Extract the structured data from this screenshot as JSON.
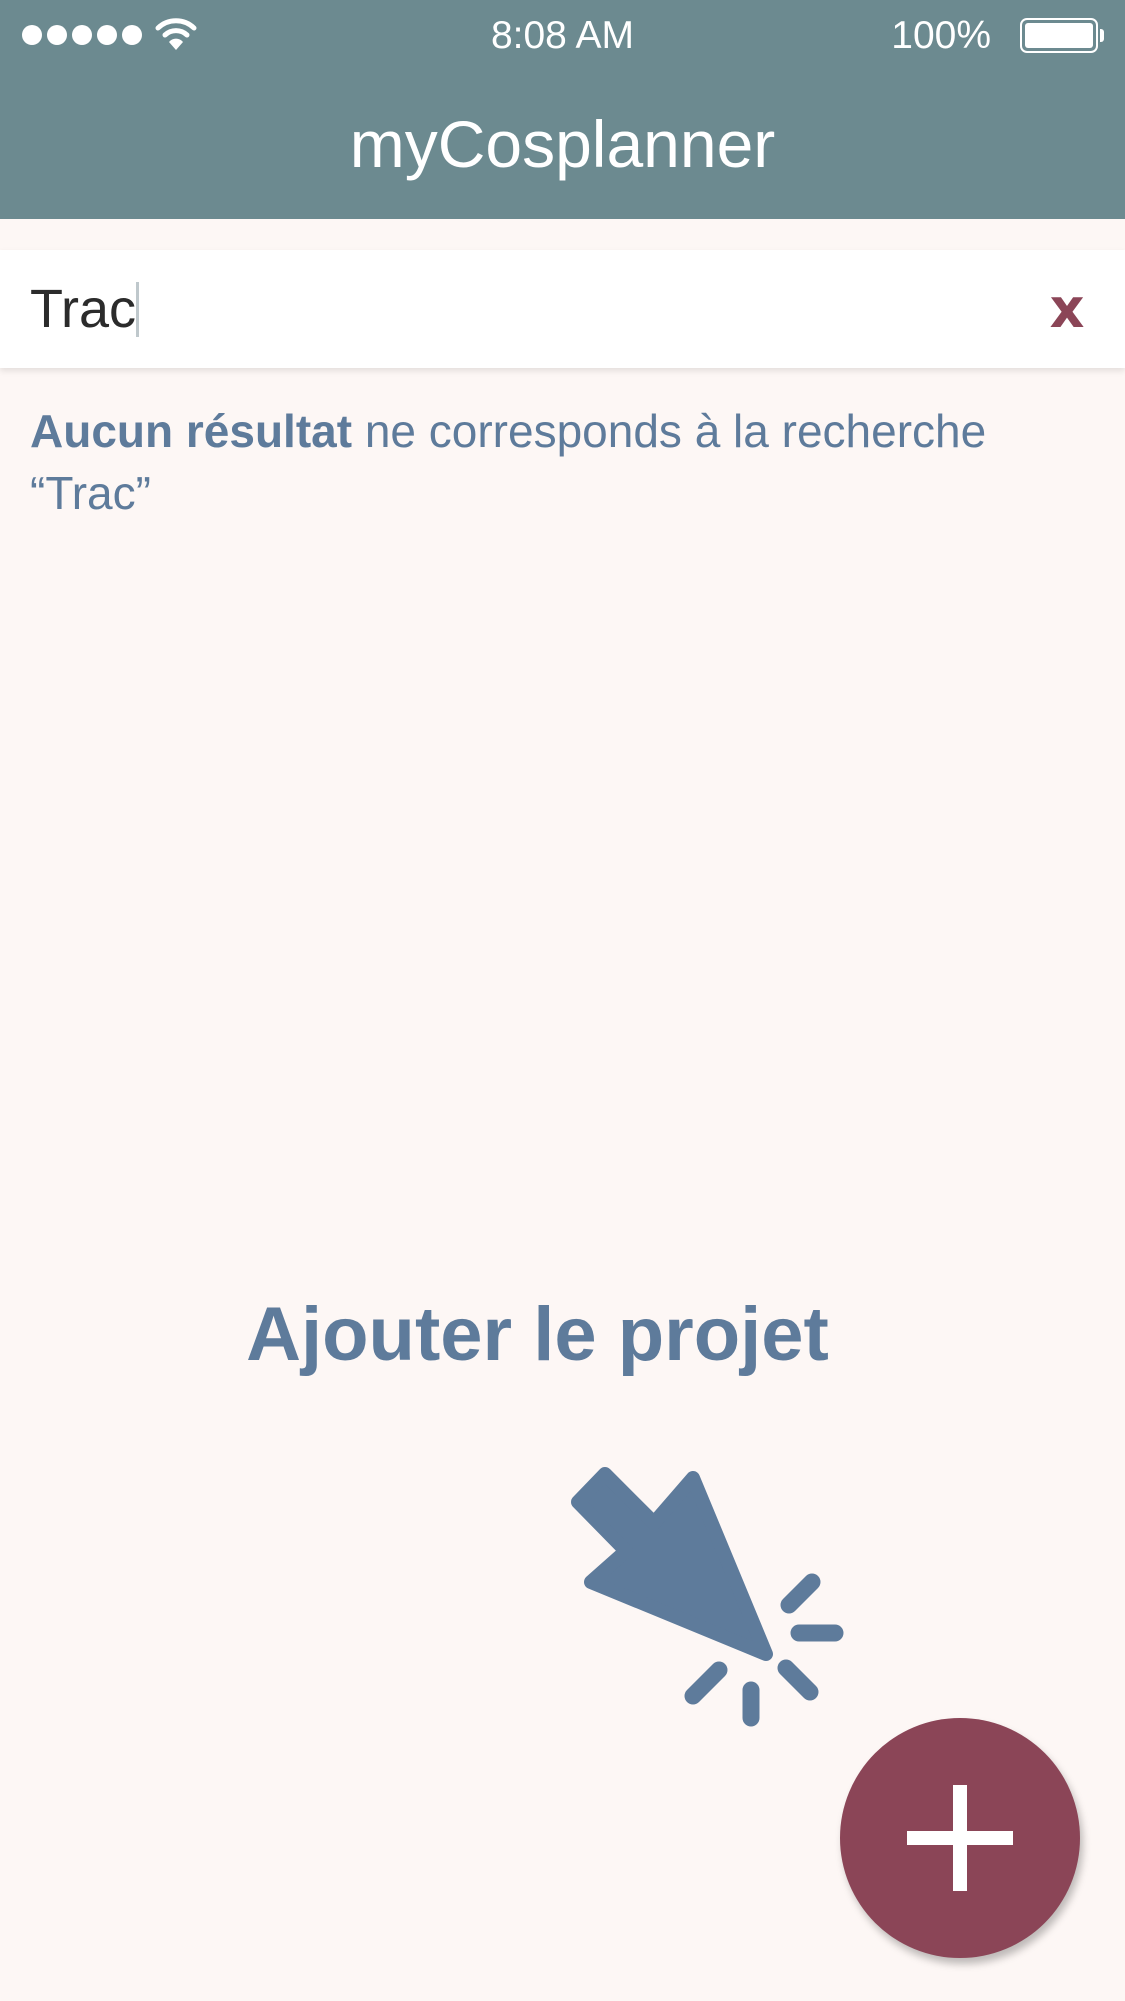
{
  "status_bar": {
    "time": "8:08 AM",
    "battery_percent": "100%",
    "signal_bars": 5,
    "signal_icon": "signal-dots-icon",
    "wifi_icon": "wifi-icon",
    "battery_icon": "battery-full-icon"
  },
  "header": {
    "title": "myCosplanner"
  },
  "search": {
    "value": "Trac",
    "clear_label": "x"
  },
  "results": {
    "empty_bold": "Aucun résultat",
    "empty_rest": " ne corresponds à la recherche “Trac”"
  },
  "cta": {
    "label": "Ajouter le projet",
    "pointer_icon": "pointer-click-icon"
  },
  "fab": {
    "icon": "plus-icon"
  },
  "colors": {
    "header_bg": "#6C8A90",
    "page_bg": "#FDF7F5",
    "accent_text": "#5E7B9B",
    "fab_bg": "#8B4557",
    "clear_x": "#8B4557"
  }
}
